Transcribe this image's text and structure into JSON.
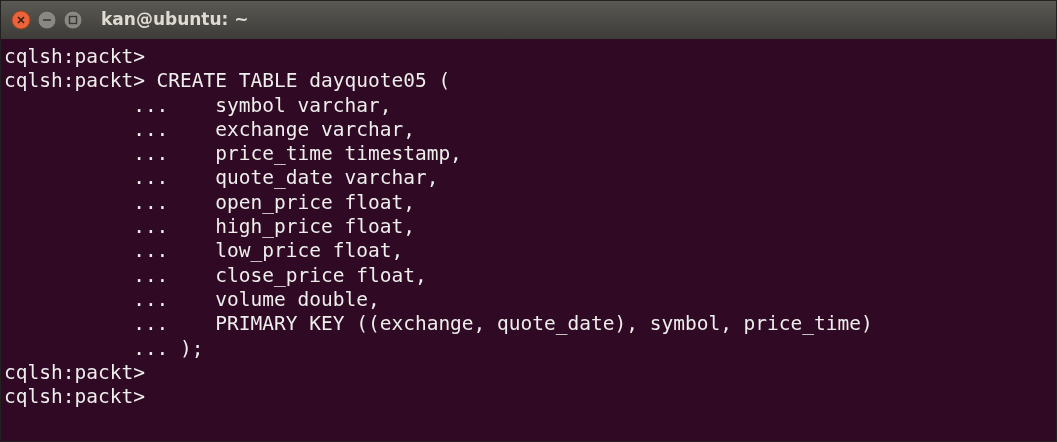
{
  "window": {
    "title": "kan@ubuntu: ~"
  },
  "terminal": {
    "lines": [
      "cqlsh:packt>",
      "cqlsh:packt> CREATE TABLE dayquote05 (",
      "           ...    symbol varchar,",
      "           ...    exchange varchar,",
      "           ...    price_time timestamp,",
      "           ...    quote_date varchar,",
      "           ...    open_price float,",
      "           ...    high_price float,",
      "           ...    low_price float,",
      "           ...    close_price float,",
      "           ...    volume double,",
      "           ...    PRIMARY KEY ((exchange, quote_date), symbol, price_time)",
      "           ... );",
      "cqlsh:packt>",
      "cqlsh:packt>"
    ]
  }
}
